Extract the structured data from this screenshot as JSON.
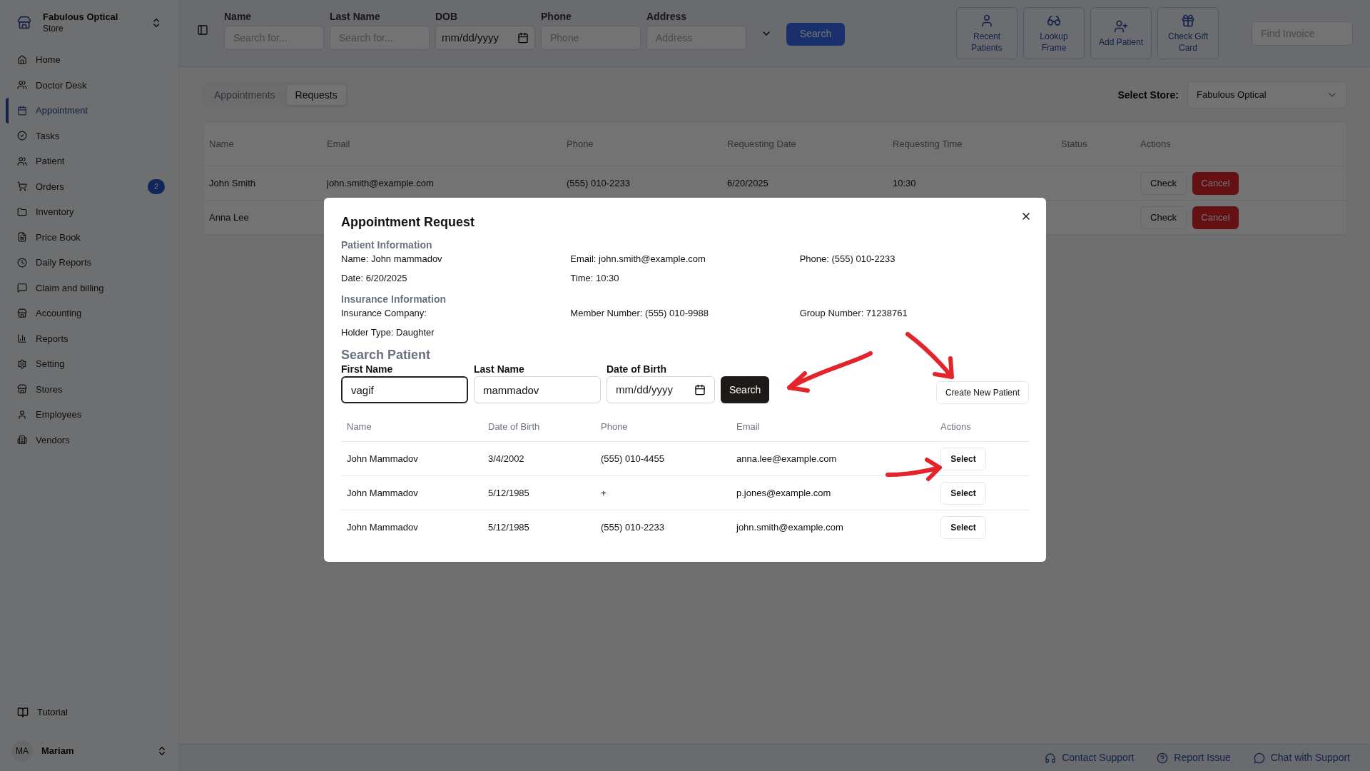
{
  "sidebar": {
    "store_name": "Fabulous Optical",
    "store_subtitle": "Store",
    "items": [
      {
        "label": "Home",
        "selected": false
      },
      {
        "label": "Doctor Desk",
        "selected": false
      },
      {
        "label": "Appointment",
        "selected": true
      },
      {
        "label": "Tasks",
        "selected": false
      },
      {
        "label": "Patient",
        "selected": false
      },
      {
        "label": "Orders",
        "selected": false,
        "badge": "2"
      },
      {
        "label": "Inventory",
        "selected": false
      },
      {
        "label": "Price Book",
        "selected": false
      },
      {
        "label": "Daily Reports",
        "selected": false
      },
      {
        "label": "Claim and billing",
        "selected": false
      },
      {
        "label": "Accounting",
        "selected": false
      },
      {
        "label": "Reports",
        "selected": false
      },
      {
        "label": "Setting",
        "selected": false
      },
      {
        "label": "Stores",
        "selected": false
      },
      {
        "label": "Employees",
        "selected": false
      },
      {
        "label": "Vendors",
        "selected": false
      }
    ],
    "tutorial": "Tutorial",
    "user": {
      "initials": "MA",
      "name": "Mariam"
    }
  },
  "search_bar": {
    "fields": [
      {
        "label": "Name",
        "placeholder": "Search for...",
        "kind": "text"
      },
      {
        "label": "Last Name",
        "placeholder": "Search for...",
        "kind": "text"
      },
      {
        "label": "DOB",
        "placeholder": "mm/dd/yyyy",
        "kind": "date"
      },
      {
        "label": "Phone",
        "placeholder": "Phone",
        "kind": "text"
      },
      {
        "label": "Address",
        "placeholder": "Address",
        "kind": "text"
      }
    ],
    "search_button": "Search",
    "quick_actions": [
      {
        "label": "Recent Patients"
      },
      {
        "label": "Lookup Frame"
      },
      {
        "label": "Add Patient"
      },
      {
        "label": "Check Gift Card"
      }
    ],
    "find_invoice_placeholder": "Find Invoice"
  },
  "tabs": [
    {
      "label": "Appointments",
      "selected": false
    },
    {
      "label": "Requests",
      "selected": true
    }
  ],
  "store_select": {
    "label": "Select Store:",
    "value": "Fabulous Optical"
  },
  "requests_table": {
    "columns": [
      "Name",
      "Email",
      "Phone",
      "Requesting Date",
      "Requesting Time",
      "Status",
      "Actions"
    ],
    "rows": [
      {
        "cells": [
          "John Smith",
          "john.smith@example.com",
          "(555) 010-2233",
          "6/20/2025",
          "10:30"
        ],
        "actions": [
          "Check",
          "Cancel"
        ]
      },
      {
        "cells": [
          "Anna Lee"
        ],
        "actions": [
          "Check",
          "Cancel"
        ]
      }
    ]
  },
  "modal": {
    "title": "Appointment Request",
    "patient_info": {
      "heading": "Patient Information",
      "fields": [
        "Name: John mammadov",
        "Email: john.smith@example.com",
        "Phone: (555) 010-2233",
        "Date: 6/20/2025",
        "Time: 10:30"
      ]
    },
    "insurance_info": {
      "heading": "Insurance Information",
      "fields": [
        "Insurance Company:",
        "Member Number: (555) 010-9988",
        "Group Number: 71238761",
        "Holder Type: Daughter"
      ]
    },
    "search": {
      "heading": "Search Patient",
      "fields": [
        {
          "label": "First Name",
          "value": "vagif",
          "kind": "text",
          "focused": true
        },
        {
          "label": "Last Name",
          "value": "mammadov",
          "kind": "text",
          "focused": false
        },
        {
          "label": "Date of Birth",
          "placeholder": "mm/dd/yyyy",
          "kind": "date",
          "focused": false
        }
      ],
      "search_button": "Search",
      "create_button": "Create New Patient"
    },
    "results": {
      "columns": [
        "Name",
        "Date of Birth",
        "Phone",
        "Email",
        "Actions"
      ],
      "rows": [
        {
          "cells": [
            "John Mammadov",
            "3/4/2002",
            "(555) 010-4455",
            "anna.lee@example.com"
          ],
          "action": "Select"
        },
        {
          "cells": [
            "John Mammadov",
            "5/12/1985",
            "+",
            "p.jones@example.com"
          ],
          "action": "Select"
        },
        {
          "cells": [
            "John Mammadov",
            "5/12/1985",
            "(555) 010-2233",
            "john.smith@example.com"
          ],
          "action": "Select"
        }
      ]
    }
  },
  "footer_links": [
    {
      "label": "Contact Support"
    },
    {
      "label": "Report Issue"
    },
    {
      "label": "Chat with Support"
    }
  ]
}
